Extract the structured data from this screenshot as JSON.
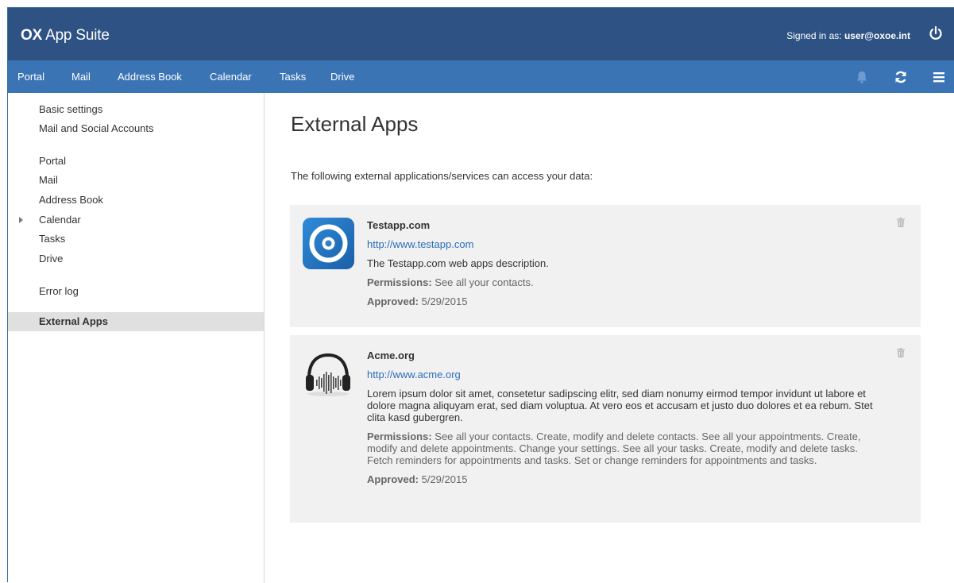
{
  "app": {
    "logo_bold": "OX",
    "logo_text": " App Suite",
    "signed_in_label": "Signed in as: ",
    "signed_in_user": "user@oxoe.int"
  },
  "nav": {
    "items": [
      "Portal",
      "Mail",
      "Address Book",
      "Calendar",
      "Tasks",
      "Drive"
    ]
  },
  "sidebar": {
    "group1": [
      "Basic settings",
      "Mail and Social Accounts"
    ],
    "group2": [
      "Portal",
      "Mail",
      "Address Book",
      "Calendar",
      "Tasks",
      "Drive"
    ],
    "error_log": "Error log",
    "active": "External Apps"
  },
  "main": {
    "title": "External Apps",
    "intro": "The following external applications/services can access your data:",
    "apps": [
      {
        "name": "Testapp.com",
        "url": "http://www.testapp.com",
        "description": "The Testapp.com web apps description.",
        "permissions_label": "Permissions:",
        "permissions": " See all your contacts.",
        "approved_label": "Approved:",
        "approved": " 5/29/2015"
      },
      {
        "name": "Acme.org",
        "url": "http://www.acme.org",
        "description": "Lorem ipsum dolor sit amet, consetetur sadipscing elitr, sed diam nonumy eirmod tempor invidunt ut labore et dolore magna aliquyam erat, sed diam voluptua. At vero eos et accusam et justo duo dolores et ea rebum. Stet clita kasd gubergren.",
        "permissions_label": "Permissions:",
        "permissions": " See all your contacts. Create, modify and delete contacts. See all your appointments. Create, modify and delete appointments. Change your settings. See all your tasks. Create, modify and delete tasks. Fetch reminders for appointments and tasks. Set or change reminders for appointments and tasks.",
        "approved_label": "Approved:",
        "approved": " 5/29/2015"
      }
    ]
  },
  "colors": {
    "topbar": "#2d5283",
    "navbar": "#3b74b5",
    "link": "#2a6ebb",
    "card_bg": "#f1f1f1",
    "active_bg": "#e0e0e0"
  },
  "icons": [
    "power-icon",
    "bell-icon",
    "refresh-icon",
    "menu-icon",
    "trash-icon",
    "caret-right-icon"
  ]
}
